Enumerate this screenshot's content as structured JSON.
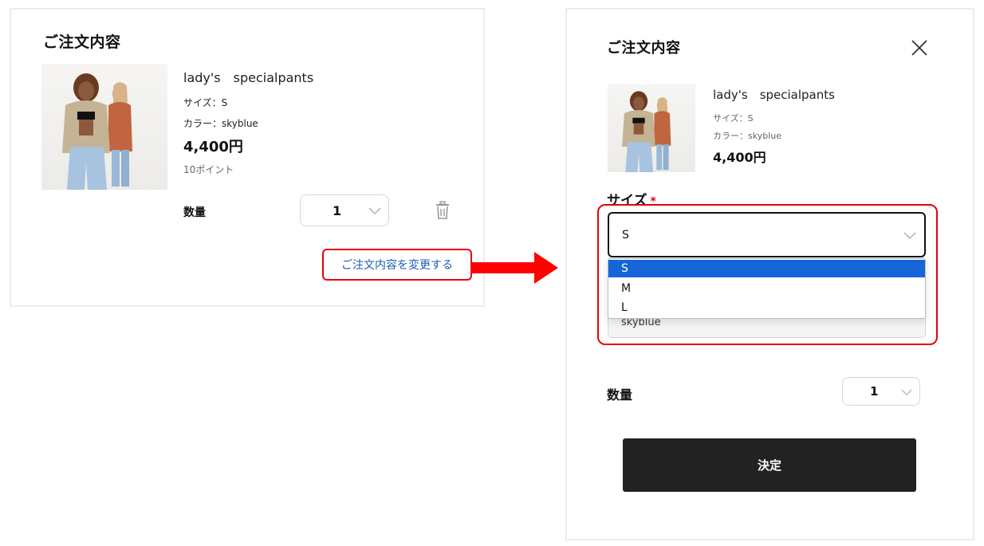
{
  "order_card": {
    "title": "ご注文内容",
    "product": {
      "name": "lady's　specialpants",
      "size_line": "サイズ：S",
      "color_line": "カラー：skyblue",
      "price": "4,400円",
      "points": "10ポイント"
    },
    "quantity_label": "数量",
    "quantity_value": "1",
    "change_link": "ご注文内容を変更する"
  },
  "edit_panel": {
    "title": "ご注文内容",
    "product": {
      "name": "lady's　specialpants",
      "size_line": "サイズ：S",
      "color_line": "カラー：skyblue",
      "price": "4,400円"
    },
    "size_field": {
      "label": "サイズ",
      "required_mark": "*",
      "selected": "S",
      "options": [
        "S",
        "M",
        "L"
      ]
    },
    "color_field": {
      "value": "skyblue"
    },
    "quantity_label": "数量",
    "quantity_value": "1",
    "decide_button": "決定"
  },
  "icons": {
    "close": "close-icon",
    "trash": "trash-icon",
    "chevron": "chevron-down-icon",
    "arrow": "right-arrow-icon"
  },
  "colors": {
    "highlight": "#e60012",
    "link": "#1a5fb4",
    "selected_option": "#1565d8",
    "button": "#222222"
  }
}
